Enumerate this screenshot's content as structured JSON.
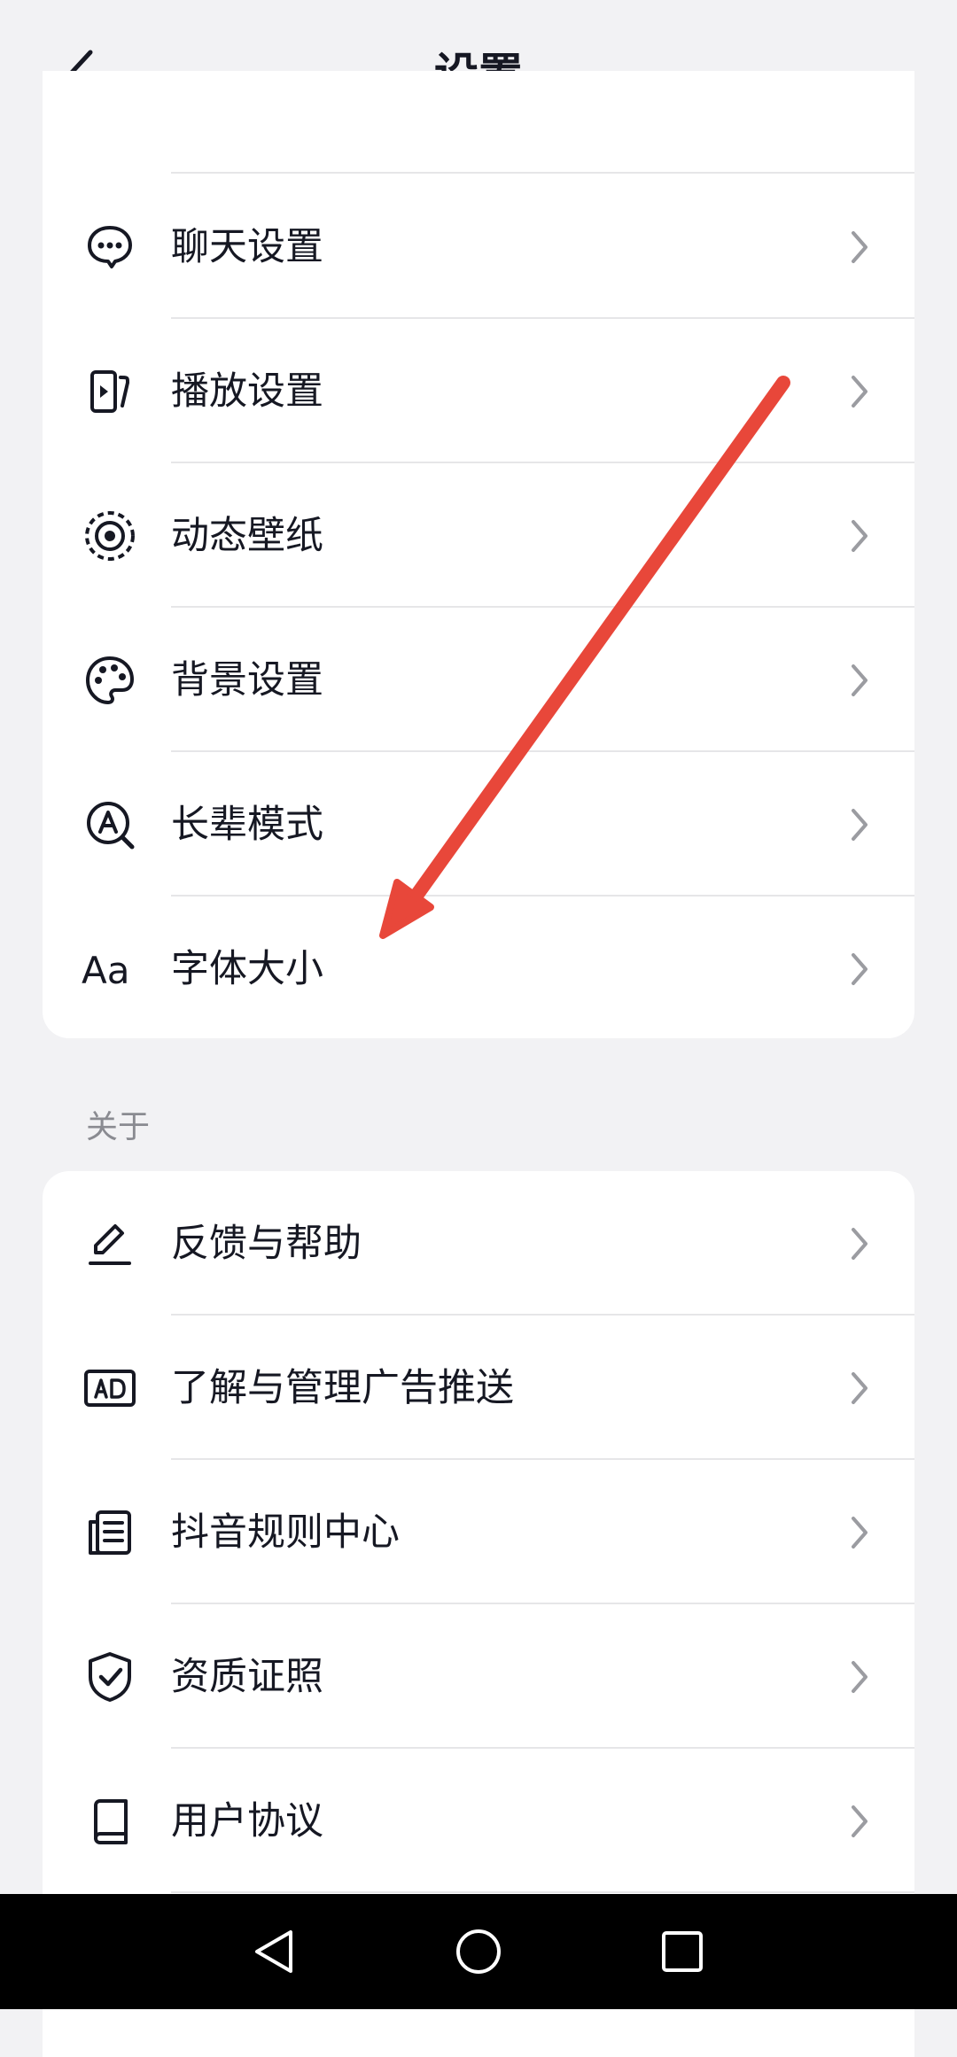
{
  "header": {
    "title": "设置"
  },
  "group1": {
    "items": [
      {
        "label": "聊天设置",
        "icon": "chat-bubble-icon"
      },
      {
        "label": "播放设置",
        "icon": "play-settings-icon"
      },
      {
        "label": "动态壁纸",
        "icon": "live-wallpaper-icon"
      },
      {
        "label": "背景设置",
        "icon": "palette-icon"
      },
      {
        "label": "长辈模式",
        "icon": "elder-mode-icon"
      },
      {
        "label": "字体大小",
        "icon": "font-size-icon"
      }
    ]
  },
  "section_about": {
    "title": "关于"
  },
  "group2": {
    "items": [
      {
        "label": "反馈与帮助",
        "icon": "pencil-icon"
      },
      {
        "label": "了解与管理广告推送",
        "icon": "ad-icon"
      },
      {
        "label": "抖音规则中心",
        "icon": "rules-doc-icon"
      },
      {
        "label": "资质证照",
        "icon": "shield-check-icon"
      },
      {
        "label": "用户协议",
        "icon": "book-icon"
      }
    ]
  },
  "colors": {
    "arrow": "#e8473a",
    "text": "#161823",
    "muted": "#8a8b91",
    "background": "#f2f2f4"
  }
}
